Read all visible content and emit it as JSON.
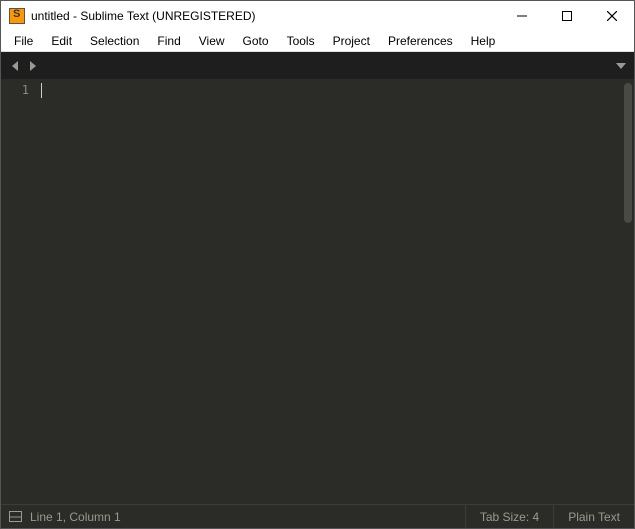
{
  "titlebar": {
    "title": "untitled - Sublime Text (UNREGISTERED)"
  },
  "menubar": {
    "items": [
      "File",
      "Edit",
      "Selection",
      "Find",
      "View",
      "Goto",
      "Tools",
      "Project",
      "Preferences",
      "Help"
    ]
  },
  "editor": {
    "gutter": {
      "line1": "1"
    },
    "content": ""
  },
  "statusbar": {
    "position": "Line 1, Column 1",
    "tab_size": "Tab Size: 4",
    "syntax": "Plain Text"
  }
}
